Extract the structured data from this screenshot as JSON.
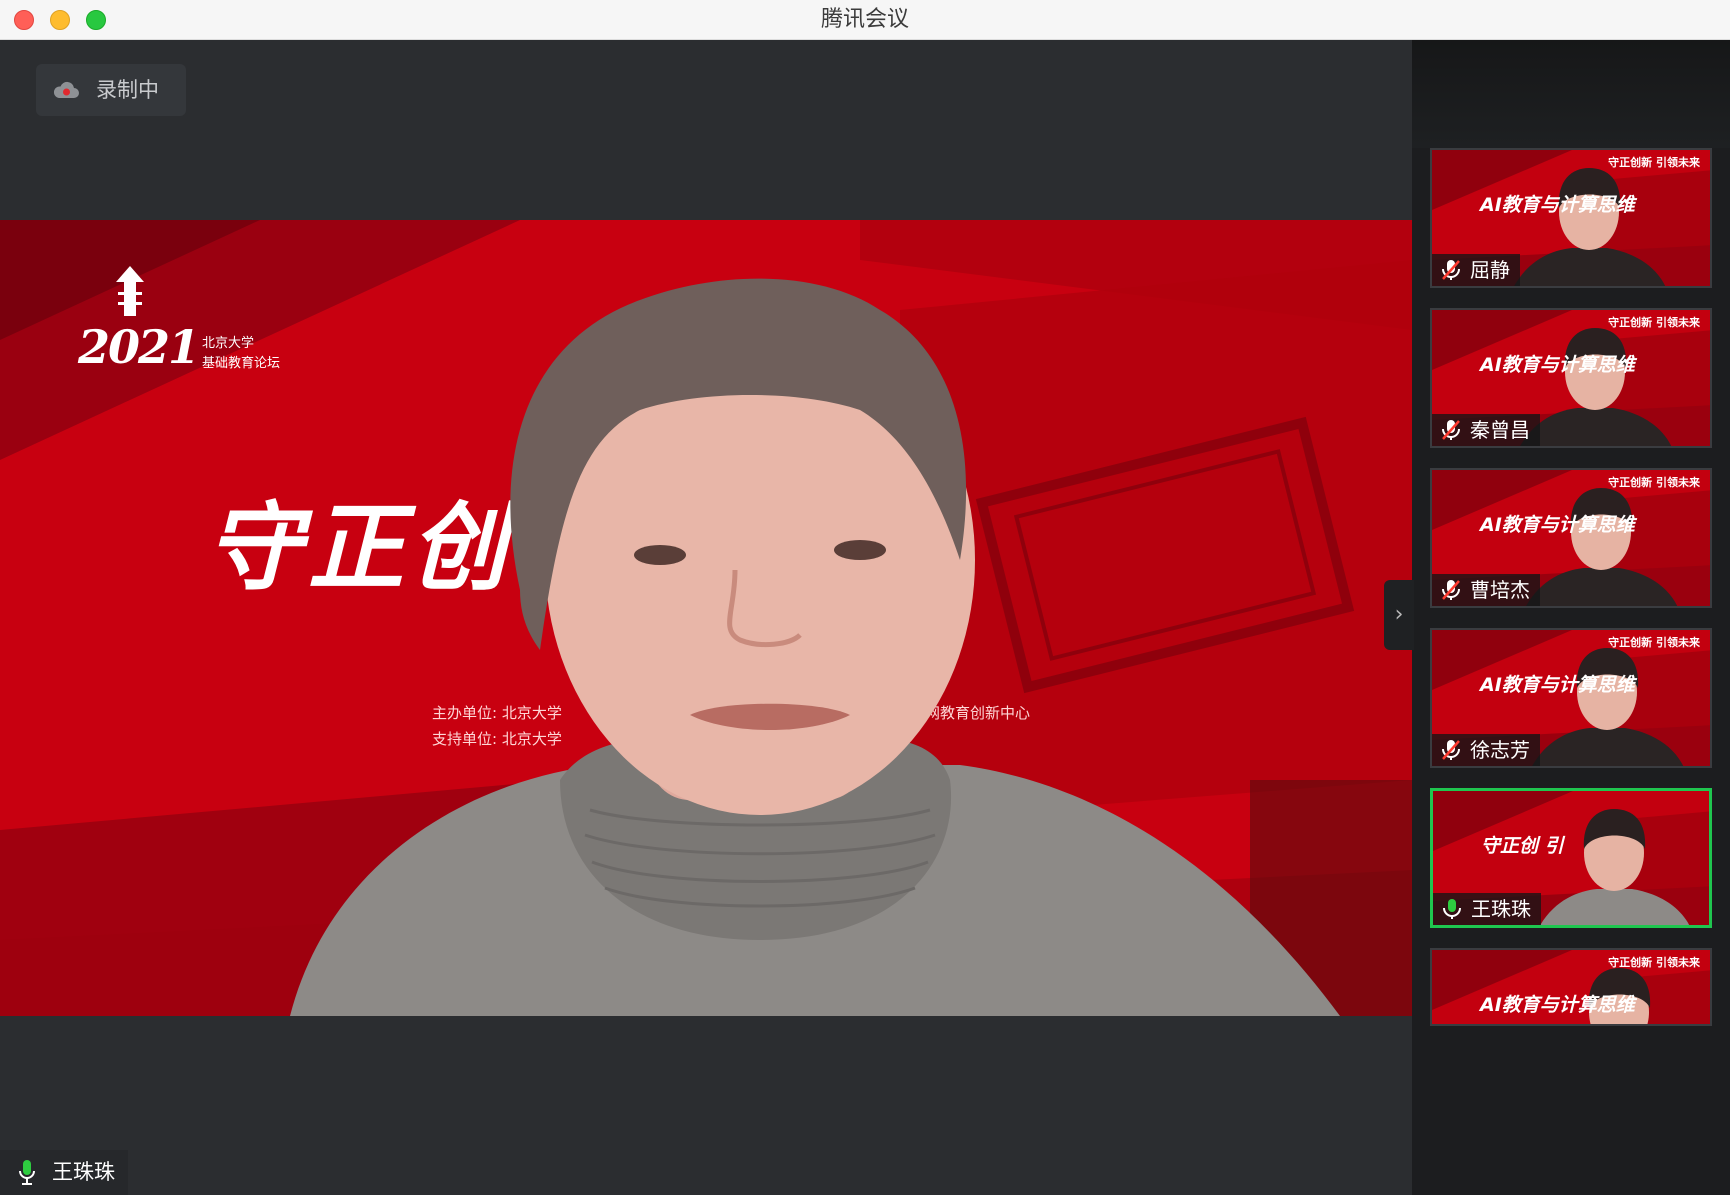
{
  "window": {
    "title": "腾讯会议"
  },
  "recording": {
    "label": "录制中",
    "icon": "cloud-record-icon"
  },
  "main_video": {
    "speaker_name": "王珠珠",
    "mic_state": "unmuted",
    "slide": {
      "logo_year": "2021",
      "logo_line1": "北京大学",
      "logo_line2": "基础教育论坛",
      "headline_visible": "守正创",
      "organizer_line": "主办单位: 北京大学",
      "organizer_line_tail": "互联网教育创新中心",
      "support_line": "支持单位: 北京大学"
    }
  },
  "gallery": {
    "expand_icon": "chevron-right-icon",
    "tiles": [
      {
        "name": "屈静",
        "mic_state": "muted",
        "slide_title": "AI教育与计算思维",
        "corner": "守正创新 引领未来",
        "active": false
      },
      {
        "name": "秦曾昌",
        "mic_state": "muted",
        "slide_title": "AI教育与计算思维",
        "corner": "守正创新 引领未来",
        "active": false
      },
      {
        "name": "曹培杰",
        "mic_state": "muted",
        "slide_title": "AI教育与计算思维",
        "corner": "守正创新 引领未来",
        "active": false
      },
      {
        "name": "徐志芳",
        "mic_state": "muted",
        "slide_title": "AI教育与计算思维",
        "corner": "守正创新 引领未来",
        "active": false
      },
      {
        "name": "王珠珠",
        "mic_state": "unmuted",
        "slide_title": "守正创 引",
        "corner": "",
        "active": true
      },
      {
        "name": "",
        "mic_state": "muted",
        "slide_title": "AI教育与计算思维",
        "corner": "守正创新 引领未来",
        "active": false
      }
    ]
  },
  "colors": {
    "slide_red": "#c80010",
    "active_border": "#1fc64f",
    "mic_green": "#2ecc40",
    "mic_muted_red": "#ff3b30",
    "background": "#2b2d30"
  }
}
